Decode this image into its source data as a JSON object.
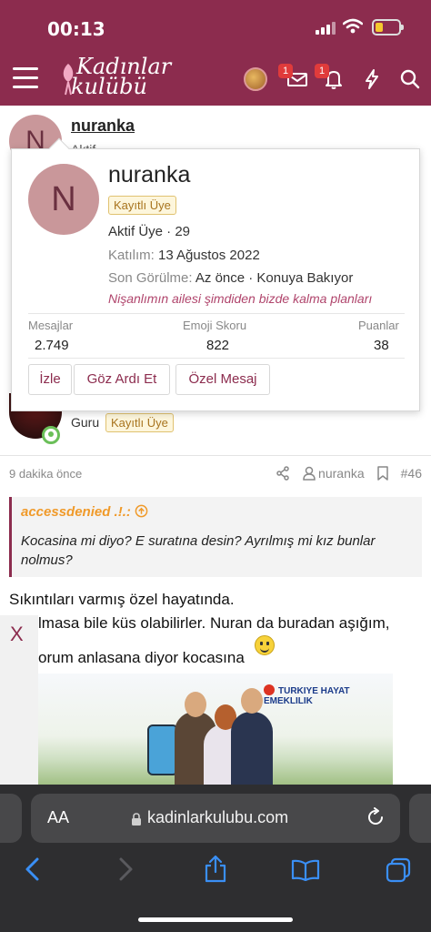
{
  "status_bar": {
    "time": "00:13"
  },
  "header": {
    "logo_line1": "Kadınlar",
    "logo_line2": "kulübü",
    "messages_badge": "1",
    "alerts_badge": "1"
  },
  "post": {
    "author_initial": "N",
    "author": "nuranka",
    "author_status_partial": "Aktif"
  },
  "profile_card": {
    "initial": "N",
    "username": "nuranka",
    "role": "Kayıtlı Üye",
    "title": "Aktif Üye · 29",
    "joined_label": "Katılım:",
    "joined_value": "13 Ağustos 2022",
    "last_seen_label": "Son Görülme:",
    "last_seen_value": "Az önce · Konuya Bakıyor",
    "status_message": "Nişanlımın ailesi şimdiden bizde kalma planları",
    "stats": [
      {
        "label": "Mesajlar",
        "value": "2.749"
      },
      {
        "label": "Emoji Skoru",
        "value": "822"
      },
      {
        "label": "Puanlar",
        "value": "38"
      }
    ],
    "buttons": {
      "follow": "İzle",
      "ignore": "Göz Ardı Et",
      "message": "Özel Mesaj"
    }
  },
  "next_post": {
    "author_title": "Guru",
    "role": "Kayıtlı Üye",
    "time": "9 dakika önce",
    "mention_user": "nuranka",
    "post_number": "#46",
    "quote_author": "accessdenied .!.:",
    "quote_text": "Kocasina mi diyo? E suratına desin? Ayrılmış mi kız bunlar nolmus?",
    "text_line1": "Sıkıntıları varmış özel hayatında.",
    "text_line2": "lmasa bile küs olabilirler. Nuran da buradan aşığım,",
    "text_line3": "orum anlasana diyor kocasına"
  },
  "ad": {
    "close": "X",
    "brand": "TURKIYE HAYAT EMEKLILIK"
  },
  "safari": {
    "aa": "AA",
    "url": "kadinlarkulubu.com"
  },
  "colors": {
    "brand": "#8c2c4e",
    "tag_bg": "#fdf6dc",
    "tag_text": "#a8741e",
    "quote_orange": "#f09a2a"
  }
}
